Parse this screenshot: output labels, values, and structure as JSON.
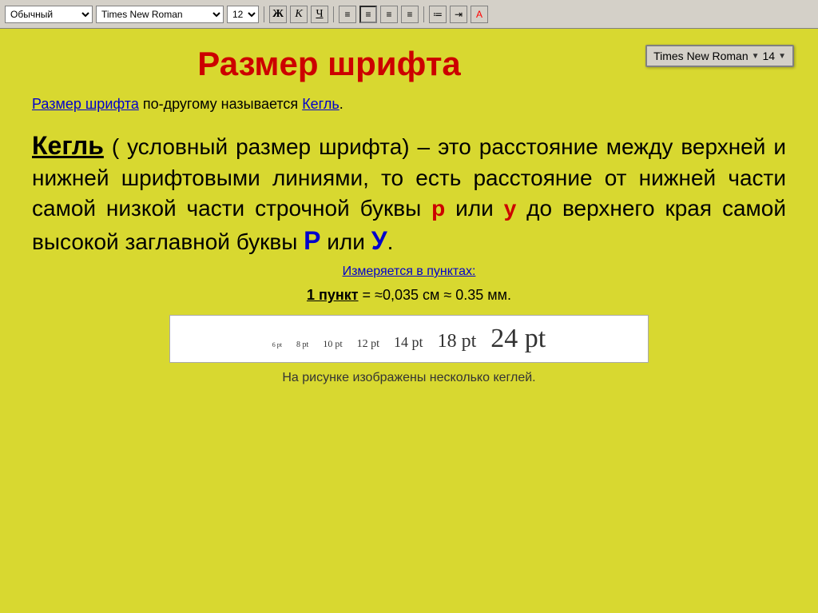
{
  "toolbar": {
    "style_label": "Обычный",
    "font_label": "Times New Roman",
    "size_label": "12",
    "bold_label": "Ж",
    "italic_label": "К",
    "underline_label": "Ч"
  },
  "font_box": {
    "name": "Times New Roman",
    "size": "14",
    "dropdown_arrow": "▼"
  },
  "page": {
    "title": "Размер шрифта",
    "subtitle_part1": "Размер шрифта",
    "subtitle_part2": " по-другому называется ",
    "subtitle_part3": "Кегль",
    "subtitle_part4": ".",
    "term": "Кегль",
    "definition": " ( условный размер шрифта) – это расстояние между верхней и нижней шрифтовыми линиями, то есть расстояние от нижней части самой низкой части строчной буквы ",
    "letter_p": "р",
    "def_middle": " или ",
    "letter_y": "у",
    "def_end": " до верхнего края самой высокой заглавной буквы ",
    "letter_P": "Р",
    "def_or": " или ",
    "letter_Y": "У",
    "def_period": ".",
    "measurement_note": "Измеряется в пунктах:",
    "point_term": "1 пункт",
    "point_def": " = ≈0,035 см ≈ 0.35 мм.",
    "sizes": [
      {
        "label": "6 pt",
        "size": 8
      },
      {
        "label": "8 pt",
        "size": 10
      },
      {
        "label": "10 pt",
        "size": 12
      },
      {
        "label": "12 pt",
        "size": 14
      },
      {
        "label": "14 pt",
        "size": 17
      },
      {
        "label": "18 pt",
        "size": 22
      },
      {
        "label": "24 pt",
        "size": 30
      }
    ],
    "caption": "На рисунке изображены несколько кеглей."
  }
}
